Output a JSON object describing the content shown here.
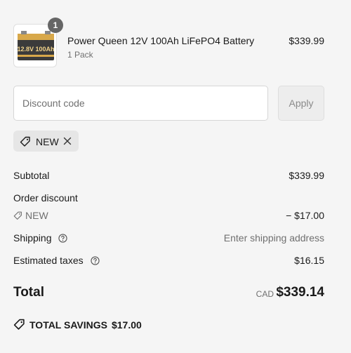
{
  "line_item": {
    "quantity": "1",
    "name": "Power Queen 12V 100Ah LiFePO4 Battery",
    "variant": "1 Pack",
    "price": "$339.99",
    "image_text": "12.8V 100Ah",
    "image_icon": "battery-product-image"
  },
  "discount": {
    "placeholder": "Discount code",
    "apply_label": "Apply",
    "applied_code": "NEW"
  },
  "summary": {
    "subtotal_label": "Subtotal",
    "subtotal_value": "$339.99",
    "order_discount_label": "Order discount",
    "discount_code": "NEW",
    "discount_value": "− $17.00",
    "shipping_label": "Shipping",
    "shipping_value": "Enter shipping address",
    "taxes_label": "Estimated taxes",
    "taxes_value": "$16.15",
    "total_label": "Total",
    "currency": "CAD",
    "total_value": "$339.14",
    "savings_label": "TOTAL SAVINGS",
    "savings_value": "$17.00"
  },
  "colors": {
    "background": "#f5f5f5",
    "badge": "#666666",
    "muted_text": "#707070",
    "chip": "#e6e6e6"
  }
}
